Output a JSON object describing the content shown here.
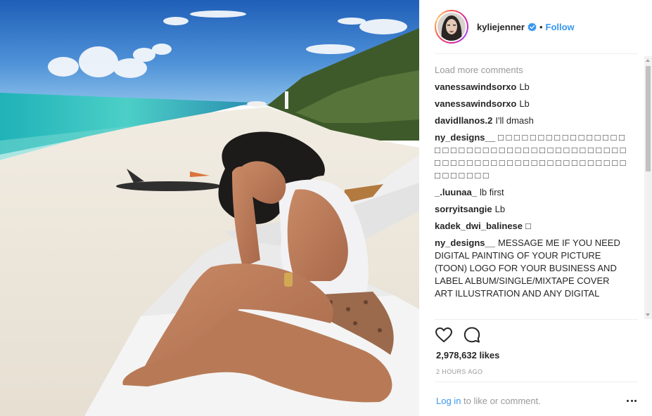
{
  "post": {
    "username": "kyliejenner",
    "dot": "•",
    "follow_label": "Follow",
    "load_more_label": "Load more comments",
    "comments": [
      {
        "user": "vanessawindsorxo",
        "text": "Lb"
      },
      {
        "user": "vanessawindsorxo",
        "text": "Lb"
      },
      {
        "user": "davidllanos.2",
        "text": "I'll dmash"
      },
      {
        "user": "ny_designs__",
        "text": "□ □ □ □ □ □ □ □ □ □ □ □ □ □ □ □ □ □ □ □ □ □ □ □ □ □ □ □ □ □ □ □ □ □ □ □ □ □ □ □ □ □ □ □ □ □ □ □ □ □ □ □ □ □ □ □ □ □ □ □ □ □ □ □ □ □ □ □ □ □ □"
      },
      {
        "user": "_.luunaa_",
        "text": "lb first"
      },
      {
        "user": "sorryitsangie",
        "text": "Lb"
      },
      {
        "user": "kadek_dwi_balinese",
        "text": "□"
      },
      {
        "user": "ny_designs__",
        "text": "MESSAGE ME IF YOU NEED DIGITAL PAINTING OF YOUR PICTURE (TOON) LOGO FOR YOUR BUSINESS AND LABEL ALBUM/SINGLE/MIXTAPE COVER ART ILLUSTRATION AND ANY DIGITAL"
      }
    ],
    "likes": "2,978,632 likes",
    "time": "2 HOURS AGO",
    "login_link": "Log in",
    "login_suffix": " to like or comment."
  },
  "icons": {
    "verified": "verified-badge-icon",
    "like": "heart-icon",
    "comment": "comment-bubble-icon",
    "more": "more-options-icon"
  },
  "colors": {
    "link_blue": "#3897f0",
    "text": "#262626",
    "muted": "#999999",
    "divider": "#efefef"
  }
}
